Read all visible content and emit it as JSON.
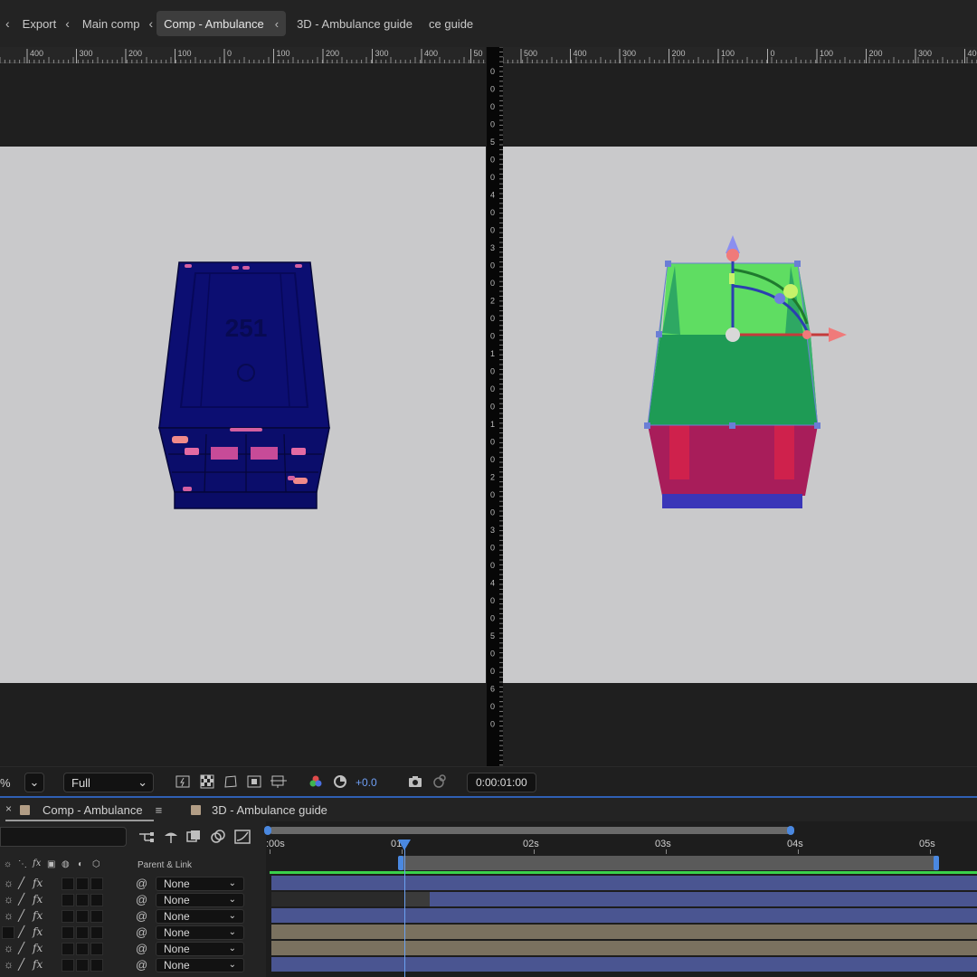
{
  "breadcrumbs": {
    "items": [
      {
        "label": "Export"
      },
      {
        "label": "Main comp"
      },
      {
        "label": "Comp - Ambulance",
        "active": true
      },
      {
        "label": "3D - Ambulance guide"
      },
      {
        "label": "ce guide"
      }
    ]
  },
  "rulers": {
    "left": [
      "400",
      "300",
      "200",
      "100",
      "0",
      "100",
      "200",
      "300",
      "400",
      "50"
    ],
    "right": [
      "500",
      "400",
      "300",
      "200",
      "100",
      "0",
      "100",
      "200",
      "300",
      "400"
    ],
    "vertical": [
      "0",
      "0",
      "0",
      "0",
      "5",
      "0",
      "0",
      "4",
      "0",
      "0",
      "3",
      "0",
      "0",
      "2",
      "0",
      "0",
      "1",
      "0",
      "0",
      "0",
      "1",
      "0",
      "0",
      "2",
      "0",
      "0",
      "3",
      "0",
      "0",
      "4",
      "0",
      "0",
      "5",
      "0",
      "0",
      "6",
      "0",
      "0"
    ]
  },
  "viewers": {
    "left": {
      "model_label": "251"
    },
    "right": {}
  },
  "viewer_toolbar": {
    "zoom_suffix": "%",
    "resolution": "Full",
    "exposure": "+0.0",
    "timecode": "0:00:01:00"
  },
  "timeline": {
    "tabs": [
      {
        "label": "Comp - Ambulance",
        "active": true
      },
      {
        "label": "3D - Ambulance guide",
        "active": false
      }
    ],
    "columns": {
      "parent_link": "Parent & Link"
    },
    "time_ticks": [
      ":00s",
      "01s",
      "02s",
      "03s",
      "04s",
      "05s"
    ],
    "current_time": "01s",
    "layers": [
      {
        "parent": "None",
        "bar_color": "#4a5591",
        "in": 0.0
      },
      {
        "parent": "None",
        "bar_color": "#4a5591",
        "in": 1.2
      },
      {
        "parent": "None",
        "bar_color": "#4a5591",
        "in": 0.0
      },
      {
        "parent": "None",
        "bar_color": "#7a715f",
        "in": 0.0
      },
      {
        "parent": "None",
        "bar_color": "#7a715f",
        "in": 0.0
      },
      {
        "parent": "None",
        "bar_color": "#4a5591",
        "in": 0.0
      }
    ]
  },
  "colors": {
    "accent": "#2f5fb4",
    "playhead": "#6aa0f0",
    "layer_blue": "#4a5591",
    "layer_tan": "#7a715f"
  }
}
